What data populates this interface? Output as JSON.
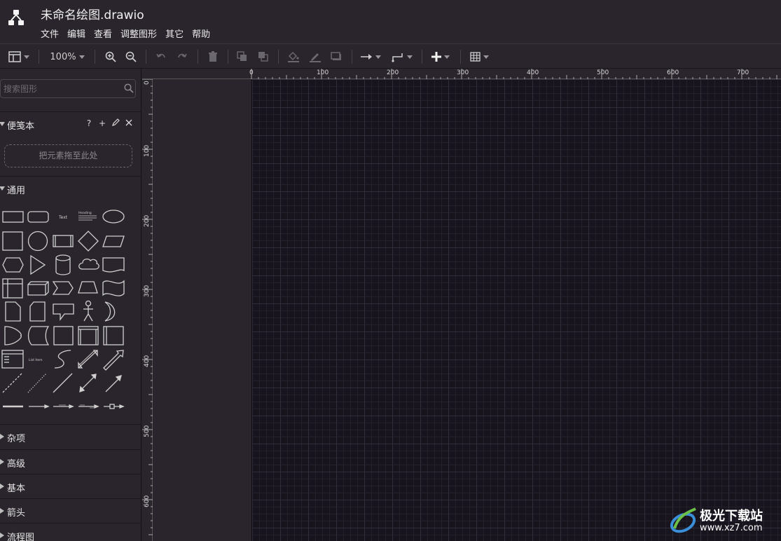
{
  "window": {
    "title": "未命名绘图.drawio"
  },
  "menu": [
    "文件",
    "编辑",
    "查看",
    "调整图形",
    "其它",
    "帮助"
  ],
  "toolbar": {
    "zoom": "100%"
  },
  "sidebar": {
    "search": {
      "placeholder": "搜索图形",
      "value": ""
    },
    "scratchpad": {
      "label": "便笺本",
      "help": "?",
      "add": "+",
      "dropzone": "把元素拖至此处"
    },
    "general": {
      "label": "通用"
    },
    "collapsed": [
      "杂项",
      "高级",
      "基本",
      "箭头",
      "流程图"
    ],
    "palette_small_text": {
      "text": "Text",
      "heading": "Heading",
      "list": "List Item"
    }
  },
  "ruler": {
    "top": [
      "0",
      "100",
      "200",
      "300",
      "400",
      "500",
      "600",
      "700"
    ],
    "left": [
      "0",
      "100",
      "200",
      "300",
      "400",
      "500",
      "600"
    ]
  },
  "watermark": {
    "brand": "极光下载站",
    "url": "www.xz7.com"
  },
  "colors": {
    "canvas": "#18141d",
    "chrome": "#2a252c",
    "grid": "#2f2d3c"
  }
}
